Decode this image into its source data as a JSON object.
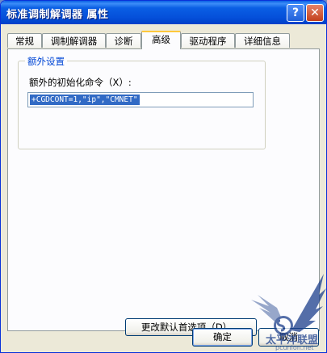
{
  "window": {
    "title": "标准调制解调器 属性",
    "help_label": "?",
    "close_label": "✕"
  },
  "tabs": [
    {
      "label": "常规",
      "active": false
    },
    {
      "label": "调制解调器",
      "active": false
    },
    {
      "label": "诊断",
      "active": false
    },
    {
      "label": "高级",
      "active": true
    },
    {
      "label": "驱动程序",
      "active": false
    },
    {
      "label": "详细信息",
      "active": false
    }
  ],
  "extra_settings": {
    "group_title": "额外设置",
    "init_label": "额外的初始化命令（X）:",
    "init_value": "+CGDCONT=1,\"ip\",\"CMNET\""
  },
  "buttons": {
    "advanced_prefs": "更改默认首选项（D）...",
    "ok": "确定",
    "cancel": "取消"
  },
  "watermark": {
    "text": "太平洋联盟",
    "url": "pcunion.net"
  }
}
